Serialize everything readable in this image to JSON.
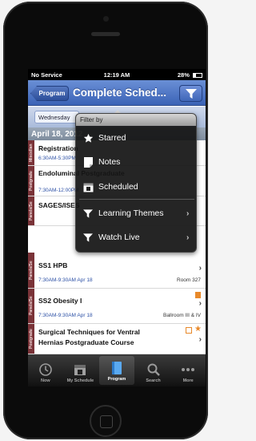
{
  "status_bar": {
    "carrier": "No Service",
    "time": "12:19 AM",
    "battery": "28%"
  },
  "navbar": {
    "back_label": "Program",
    "title": "Complete Sched...",
    "filter_icon": "filter-icon"
  },
  "day_strip": {
    "selected_day": "Wednesday"
  },
  "date_header": "April 18, 2012",
  "sessions": [
    {
      "category": "Miscellan",
      "title": "Registration",
      "meta": "6:30AM-5:30PM",
      "room": "",
      "starred": false,
      "notes": false
    },
    {
      "category": "Postgradu",
      "title": "Endoluminal Postgraduate",
      "title2": "Postgraduate",
      "meta": "7:30AM-12:00PM",
      "room": "",
      "starred": false,
      "notes": false
    },
    {
      "category": "Panels/Se",
      "title": "SAGES/ISES",
      "meta": "",
      "room": "",
      "starred": false,
      "notes": false
    },
    {
      "category": "Panels/Se",
      "title": "SS1 HPB",
      "meta": "7:30AM-9:30AM   Apr 18",
      "room": "Room 327",
      "starred": false,
      "notes": false
    },
    {
      "category": "Panels/Se",
      "title": "SS2 Obesity I",
      "meta": "7:30AM-9:30AM   Apr 18",
      "room": "Ballroom III & IV",
      "starred": false,
      "notes": true
    },
    {
      "category": "Postgradu",
      "title": "Surgical Techniques for Ventral",
      "title2": "Hernias Postgraduate Course",
      "meta": "",
      "room": "",
      "starred": true,
      "notes": true
    }
  ],
  "filter_popover": {
    "header": "Filter by",
    "items": [
      {
        "label": "Starred",
        "icon": "star-icon",
        "has_chevron": false
      },
      {
        "label": "Notes",
        "icon": "note-icon",
        "has_chevron": false
      },
      {
        "label": "Scheduled",
        "icon": "calendar-icon",
        "has_chevron": false
      },
      {
        "label": "Learning Themes",
        "icon": "filter-icon",
        "has_chevron": true
      },
      {
        "label": "Watch Live",
        "icon": "filter-icon",
        "has_chevron": true
      }
    ]
  },
  "tab_bar": [
    {
      "label": "Now",
      "icon": "clock-icon",
      "active": false
    },
    {
      "label": "My Schedule",
      "icon": "calendar-icon",
      "active": false
    },
    {
      "label": "Program",
      "icon": "book-icon",
      "active": true
    },
    {
      "label": "Search",
      "icon": "search-icon",
      "active": false
    },
    {
      "label": "More",
      "icon": "more-dots-icon",
      "active": false
    }
  ],
  "colors": {
    "nav_blue": "#3b63b6",
    "category_red": "#7a3338",
    "link_blue": "#2b4fa5",
    "note_orange": "#e8892a"
  }
}
